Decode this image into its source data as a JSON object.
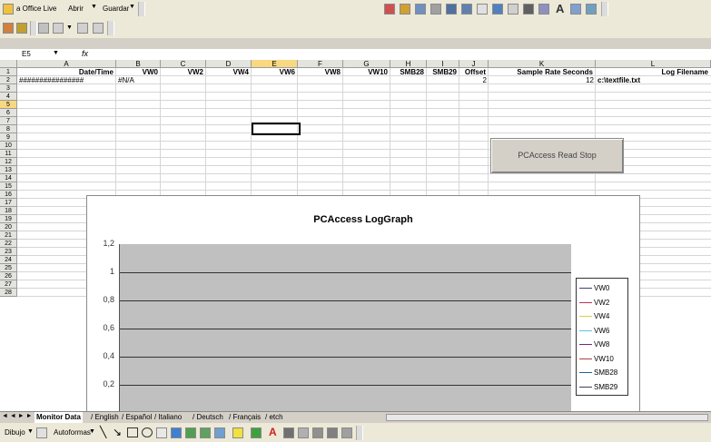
{
  "toolbar": {
    "office_live": "a Office Live",
    "open_label": "Abrir",
    "save_label": "Guardar"
  },
  "formula_bar": {
    "name_box": "E5",
    "fx": "fx"
  },
  "columns": [
    "A",
    "B",
    "C",
    "D",
    "E",
    "F",
    "G",
    "H",
    "I",
    "J",
    "K",
    "L"
  ],
  "rows": [
    "1",
    "2",
    "3",
    "4",
    "5",
    "6",
    "7",
    "8",
    "9",
    "10",
    "11",
    "12",
    "13",
    "14",
    "15",
    "16",
    "17",
    "18",
    "19",
    "20",
    "21",
    "22",
    "23",
    "24",
    "25",
    "26",
    "27",
    "28"
  ],
  "header_row": {
    "A": "Date/Time",
    "B": "VW0",
    "C": "VW2",
    "D": "VW4",
    "E": "VW6",
    "F": "VW8",
    "G": "VW10",
    "H": "SMB28",
    "I": "SMB29",
    "J": "Offset",
    "K": "Sample Rate Seconds",
    "L": "Log Filename"
  },
  "row2": {
    "A": "################",
    "B": "#N/A",
    "J": "2",
    "K": "12",
    "L": "c:\\textfile.txt"
  },
  "button": {
    "label": "PCAccess Read Stop"
  },
  "chart": {
    "title": "PCAccess LogGraph",
    "y_ticks": [
      "1,2",
      "1",
      "0,8",
      "0,6",
      "0,4",
      "0,2"
    ],
    "legend": [
      {
        "name": "VW0",
        "color": "#404080"
      },
      {
        "name": "VW2",
        "color": "#c03060"
      },
      {
        "name": "VW4",
        "color": "#e0d040"
      },
      {
        "name": "VW6",
        "color": "#60c0e0"
      },
      {
        "name": "VW8",
        "color": "#802080"
      },
      {
        "name": "VW10",
        "color": "#b04040"
      },
      {
        "name": "SMB28",
        "color": "#2060a0"
      },
      {
        "name": "SMB29",
        "color": "#404060"
      }
    ]
  },
  "chart_data": {
    "type": "line",
    "title": "PCAccess LogGraph",
    "series": [
      {
        "name": "VW0",
        "values": []
      },
      {
        "name": "VW2",
        "values": []
      },
      {
        "name": "VW4",
        "values": []
      },
      {
        "name": "VW6",
        "values": []
      },
      {
        "name": "VW8",
        "values": []
      },
      {
        "name": "VW10",
        "values": []
      },
      {
        "name": "SMB28",
        "values": []
      },
      {
        "name": "SMB29",
        "values": []
      }
    ],
    "ylim": [
      0,
      1.2
    ],
    "grid": true,
    "legend_position": "right"
  },
  "sheet_tabs": {
    "nav": "◄ ◄ ► ►",
    "tabs": [
      "Monitor Data",
      "English",
      "Español",
      "Italiano",
      "Deutsch",
      "Français",
      "etch"
    ]
  },
  "draw_bar": {
    "draw_label": "Dibujo",
    "autoshapes_label": "Autoformas"
  }
}
